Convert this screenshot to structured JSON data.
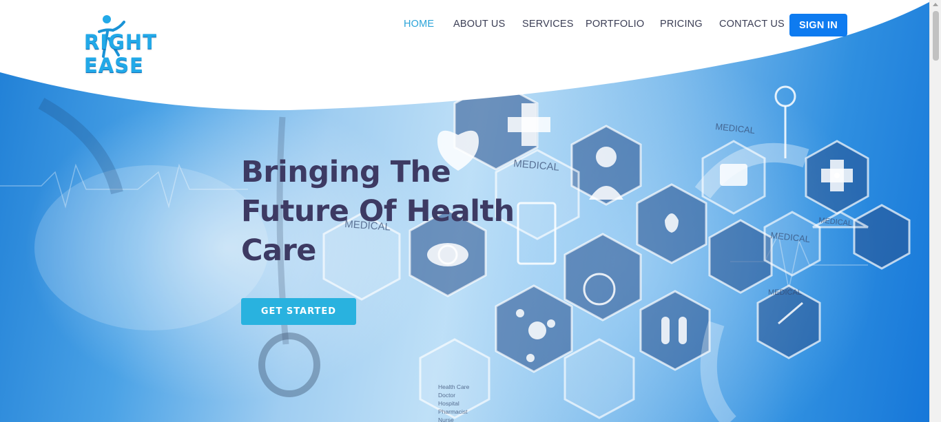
{
  "brand": {
    "logo_text": "RIGHT EASE"
  },
  "nav": {
    "items": [
      {
        "label": "HOME",
        "active": true
      },
      {
        "label": "ABOUT US",
        "active": false
      },
      {
        "label": "SERVICES",
        "active": false
      },
      {
        "label": "PORTFOLIO",
        "active": false
      },
      {
        "label": "PRICING",
        "active": false
      },
      {
        "label": "CONTACT US",
        "active": false
      }
    ],
    "signin_label": "SIGN IN"
  },
  "hero": {
    "headline": "Bringing The Future Of Health Care",
    "cta_label": "GET STARTED",
    "background_labels": {
      "medical": "MEDICAL",
      "list": [
        "Health Care",
        "Doctor",
        "Hospital",
        "Pharmacist",
        "Nurse"
      ]
    }
  },
  "colors": {
    "accent": "#2aa3d8",
    "signin_bg": "#0e7bf0",
    "cta_bg": "#29b2df",
    "headline": "#3d3a63",
    "nav_text": "#3b3e55"
  }
}
